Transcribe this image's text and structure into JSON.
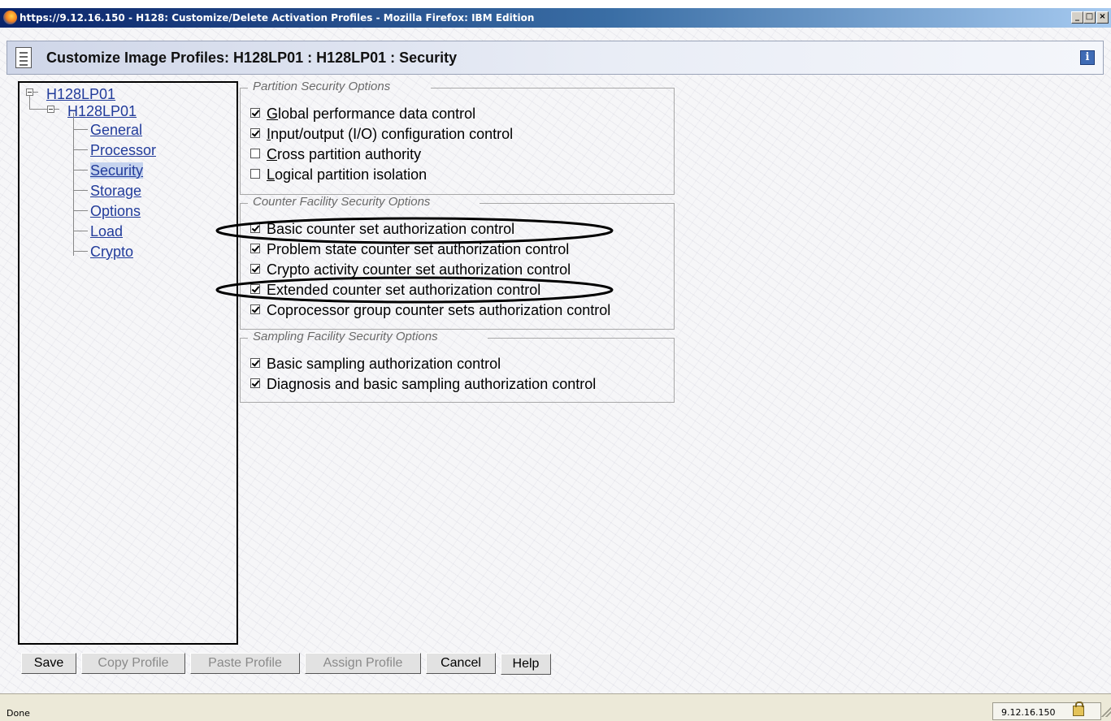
{
  "window": {
    "title": "https://9.12.16.150 - H128: Customize/Delete Activation Profiles - Mozilla Firefox: IBM Edition"
  },
  "header": {
    "title": "Customize Image Profiles: H128LP01 : H128LP01 : Security"
  },
  "tree": {
    "root": "H128LP01",
    "profile": "H128LP01",
    "items": [
      "General",
      "Processor",
      "Security",
      "Storage",
      "Options",
      "Load",
      "Crypto"
    ],
    "selected": "Security"
  },
  "groups": [
    {
      "legend": "Partition Security Options",
      "options": [
        {
          "pre": "",
          "acc": "G",
          "post": "lobal performance data control",
          "checked": true
        },
        {
          "pre": "",
          "acc": "I",
          "post": "nput/output (I/O) configuration control",
          "checked": true
        },
        {
          "pre": "",
          "acc": "C",
          "post": "ross partition authority",
          "checked": false
        },
        {
          "pre": "",
          "acc": "L",
          "post": "ogical partition isolation",
          "checked": false
        }
      ]
    },
    {
      "legend": "Counter Facility Security Options",
      "options": [
        {
          "pre": "Basic counter set authorization control",
          "acc": "",
          "post": "",
          "checked": true
        },
        {
          "pre": "Problem state counter set authorization control",
          "acc": "",
          "post": "",
          "checked": true
        },
        {
          "pre": "Crypto activity counter set authorization control",
          "acc": "",
          "post": "",
          "checked": true
        },
        {
          "pre": "Extended counter set authorization control",
          "acc": "",
          "post": "",
          "checked": true
        },
        {
          "pre": "Coprocessor group counter sets authorization control",
          "acc": "",
          "post": "",
          "checked": true
        }
      ]
    },
    {
      "legend": "Sampling Facility Security Options",
      "options": [
        {
          "pre": "Basic sampling authorization control",
          "acc": "",
          "post": "",
          "checked": true
        },
        {
          "pre": "Diagnosis and basic sampling authorization control",
          "acc": "",
          "post": "",
          "checked": true
        }
      ]
    }
  ],
  "buttons": {
    "save": "Save",
    "copy_profile": "Copy Profile",
    "paste_profile": "Paste Profile",
    "assign_profile": "Assign Profile",
    "cancel": "Cancel",
    "help": "Help"
  },
  "status": {
    "text": "Done",
    "address": "9.12.16.150"
  },
  "icons": {
    "browser": "firefox-icon",
    "doc": "document-icon",
    "info": "info-icon",
    "lock": "lock-icon"
  }
}
